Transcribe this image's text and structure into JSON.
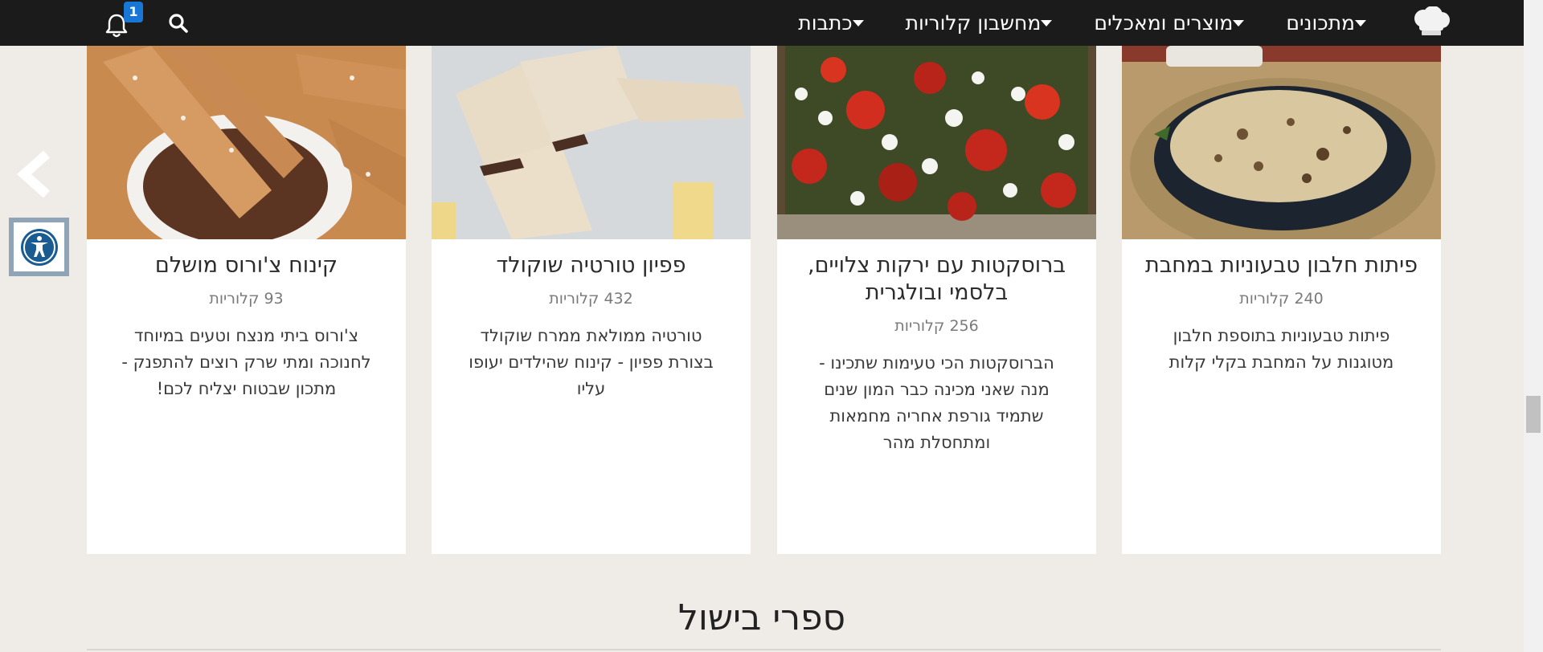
{
  "nav": {
    "menu": [
      {
        "label": "מתכונים",
        "has_dropdown": true
      },
      {
        "label": "מוצרים ומאכלים",
        "has_dropdown": true
      },
      {
        "label": "מחשבון קלוריות",
        "has_dropdown": true
      },
      {
        "label": "כתבות",
        "has_dropdown": true
      }
    ],
    "notifications_count": "1",
    "icons": {
      "logo": "chef-hat-logo-icon",
      "search": "search-icon",
      "bell": "bell-icon"
    }
  },
  "side_controls": {
    "prev": "chevron-left-icon",
    "accessibility": "accessibility-icon"
  },
  "cards": [
    {
      "title": "פיתות חלבון טבעוניות במחבת",
      "calories": "240 קלוריות",
      "description": "פיתות טבעוניות בתוספת חלבון מטוגנות על המחבת בקלי קלות"
    },
    {
      "title": "ברוסקטות עם ירקות צלויים, בלסמי ובולגרית",
      "calories": "256 קלוריות",
      "description": "הברוסקטות הכי טעימות שתכינו - מנה שאני מכינה כבר המון שנים שתמיד גורפת אחריה מחמאות ומתחסלת מהר"
    },
    {
      "title": "פפיון טורטיה שוקולד",
      "calories": "432 קלוריות",
      "description": "טורטיה ממולאת ממרח שוקולד בצורת פפיון - קינוח שהילדים יעופו עליו"
    },
    {
      "title": "קינוח צ'ורוס מושלם",
      "calories": "93 קלוריות",
      "description": "צ'ורוס ביתי מנצח וטעים במיוחד לחנוכה ומתי שרק רוצים להתפנק - מתכון שבטוח יצליח לכם!"
    }
  ],
  "section": {
    "title": "ספרי בישול"
  },
  "colors": {
    "nav_bg": "#1b1b1b",
    "page_bg": "#efebe7",
    "badge": "#1776d6",
    "a11y_border": "#8fa4b6"
  }
}
